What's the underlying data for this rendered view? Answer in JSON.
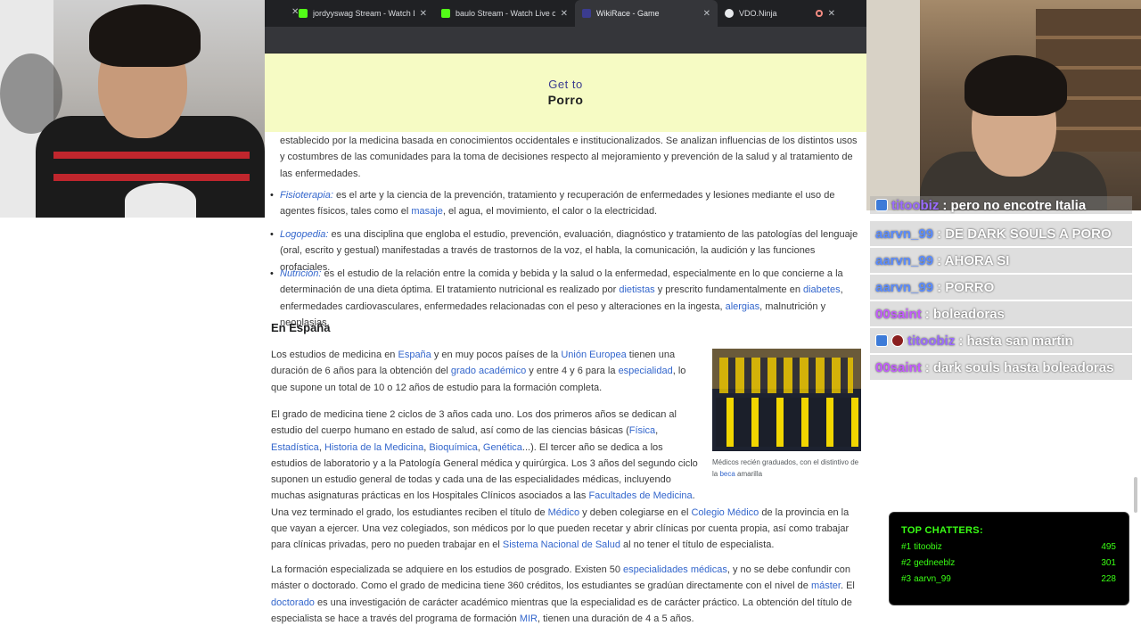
{
  "tabs": [
    {
      "label": "jordyyswag Stream - Watch Live",
      "favicon": "kick-icon",
      "active": false
    },
    {
      "label": "baulo Stream - Watch Live on K",
      "favicon": "kick-icon",
      "active": false
    },
    {
      "label": "WikiRace - Game",
      "favicon": "wikirace-icon",
      "active": true
    },
    {
      "label": "VDO.Ninja",
      "favicon": "vdo-ninja-icon",
      "active": false
    }
  ],
  "race": {
    "goal_label": "Get to",
    "goal_target": "Porro"
  },
  "article": {
    "intro_fragment": "establecido por la medicina basada en conocimientos occidentales e institucionalizados. Se analizan influencias de los distintos usos y costumbres de las comunidades para la toma de decisiones respecto al mejoramiento y prevención de la salud y al tratamiento de las enfermedades.",
    "items": [
      {
        "term": "Fisioterapia:",
        "text_before": " es el arte y la ciencia de la prevención, tratamiento y recuperación de enfermedades y lesiones mediante el uso de agentes físicos, tales como el ",
        "link": "masaje",
        "text_after": ", el agua, el movimiento, el calor o la electricidad."
      },
      {
        "term": "Logopedia:",
        "text_before": " es una disciplina que engloba el estudio, prevención, evaluación, diagnóstico y tratamiento de las patologías del lenguaje (oral, escrito y gestual) manifestadas a través de trastornos de la voz, el habla, la comunicación, la audición y las funciones orofaciales.",
        "link": "",
        "text_after": ""
      },
      {
        "term": "Nutrición:",
        "text_before": " es el estudio de la relación entre la comida y bebida y la salud o la enfermedad, especialmente en lo que concierne a la determinación de una dieta óptima. El tratamiento nutricional es realizado por ",
        "link": "dietistas",
        "text_mid": " y prescrito fundamentalmente en ",
        "link2": "diabetes",
        "text_after": ", enfermedades cardiovasculares, enfermedades relacionadas con el peso y alteraciones en la ingesta, ",
        "link3": "alergias",
        "text_end": ", malnutrición y neoplasias."
      }
    ],
    "section_heading": "En España",
    "p1": {
      "t1": "Los estudios de medicina en ",
      "l1": "España",
      "t2": " y en muy pocos países de la ",
      "l2": "Unión Europea",
      "t3": " tienen una duración de 6 años para la obtención del ",
      "l3": "grado académico",
      "t4": " y entre 4 y 6 para la ",
      "l4": "especialidad",
      "t5": ", lo que supone un total de 10 o 12 años de estudio para la formación completa."
    },
    "p2": {
      "t1": "El grado de medicina tiene 2 ciclos de 3 años cada uno. Los dos primeros años se dedican al estudio del cuerpo humano en estado de salud, así como de las ciencias básicas (",
      "l1": "Física",
      "t2": ", ",
      "l2": "Estadística",
      "t3": ", ",
      "l3": "Historia de la Medicina",
      "t4": ", ",
      "l4": "Bioquímica",
      "t5": ", ",
      "l5": "Genética",
      "t6": "...). El tercer año se dedica a los estudios de laboratorio y a la Patología General médica y quirúrgica. Los 3 años del segundo ciclo suponen un estudio general de todas y cada una de las especialidades médicas, incluyendo muchas asignaturas prácticas en los Hospitales Clínicos asociados a las ",
      "l6": "Facultades de Medicina",
      "t7": ". Una vez terminado el grado, los estudiantes reciben el título de ",
      "l7": "Médico",
      "t8": " y deben colegiarse en el ",
      "l8": "Colegio Médico",
      "t9": " de la provincia en la que vayan a ejercer. Una vez colegiados, son médicos por lo que pueden recetar y abrir clínicas por cuenta propia, así como trabajar para clínicas privadas, pero no pueden trabajar en el ",
      "l9": "Sistema Nacional de Salud",
      "t10": " al no tener el título de especialista."
    },
    "p3": {
      "t1": "La formación especializada se adquiere en los estudios de posgrado. Existen 50 ",
      "l1": "especialidades médicas",
      "t2": ", y no se debe confundir con máster o doctorado. Como el grado de medicina tiene 360 créditos, los estudiantes se gradúan directamente con el nivel de ",
      "l2": "máster",
      "t3": ". El ",
      "l3": "doctorado",
      "t4": " es una investigación de carácter académico mientras que la especialidad es de carácter práctico. La obtención del título de especialista se hace a través del programa de formación ",
      "l4": "MIR",
      "t5": ", tienen una duración de 4 a 5 años."
    },
    "figure": {
      "caption_before": "Médicos recién graduados, con el distintivo de la ",
      "caption_link": "beca",
      "caption_after": " amarilla"
    }
  },
  "chat": [
    {
      "user": "titoobiz",
      "message": ": pero no encotre Italia",
      "user_color": "#9b6bff"
    },
    {
      "user": "aarvn_99",
      "message": ": DE DARK SOULS A PORO",
      "user_color": "#5b8cff"
    },
    {
      "user": "aarvn_99",
      "message": ": AHORA SI",
      "user_color": "#5b8cff"
    },
    {
      "user": "aarvn_99",
      "message": ": PORRO",
      "user_color": "#5b8cff"
    },
    {
      "user": "00saint",
      "message": ": boleadoras",
      "user_color": "#c45bff"
    },
    {
      "user": "titoobiz",
      "message": ": hasta san martin",
      "user_color": "#9b6bff"
    },
    {
      "user": "00saint",
      "message": ": dark souls hasta boleadoras",
      "user_color": "#c45bff"
    }
  ],
  "top_chatters": {
    "title": "TOP CHATTERS:",
    "rows": [
      {
        "rank": "#1",
        "name": "titoobiz",
        "count": "495"
      },
      {
        "rank": "#2",
        "name": "gedneeblz",
        "count": "301"
      },
      {
        "rank": "#3",
        "name": "aarvn_99",
        "count": "228"
      }
    ]
  },
  "colors": {
    "banner_bg": "#f6fbc4",
    "link": "#3366cc",
    "chatters_text": "#39ff14",
    "tabbar_bg": "#202124"
  }
}
